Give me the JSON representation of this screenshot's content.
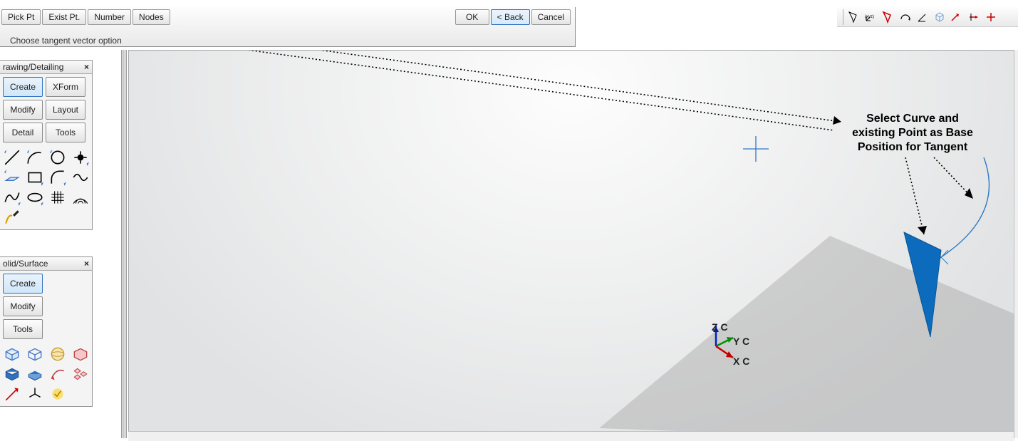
{
  "top": {
    "pick_pt": "Pick Pt",
    "exist_pt": "Exist Pt.",
    "number": "Number",
    "nodes": "Nodes",
    "ok": "OK",
    "back": "< Back",
    "cancel": "Cancel",
    "status": "Choose tangent vector option"
  },
  "panel1": {
    "title": "rawing/Detailing",
    "create": "Create",
    "xform": "XForm",
    "modify": "Modify",
    "layout": "Layout",
    "detail": "Detail",
    "tools": "Tools"
  },
  "panel2": {
    "title": "olid/Surface",
    "create": "Create",
    "modify": "Modify",
    "tools": "Tools"
  },
  "annotation": {
    "l1": "Select Curve and",
    "l2": "existing Point as Base",
    "l3": "Position for Tangent"
  },
  "axis": {
    "z": "Z C",
    "y": "Y C",
    "x": "X C"
  }
}
